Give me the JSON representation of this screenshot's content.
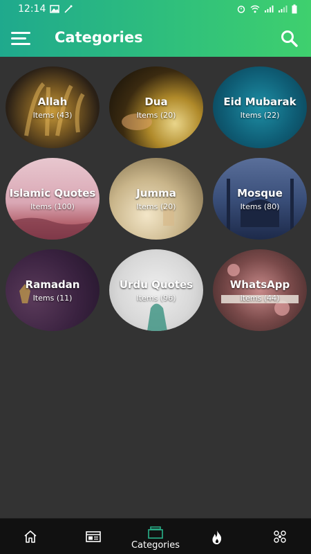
{
  "status_bar": {
    "time": "12:14"
  },
  "header": {
    "title": "Categories"
  },
  "categories": [
    {
      "name": "Allah",
      "count": "Items (43)"
    },
    {
      "name": "Dua",
      "count": "Items (20)"
    },
    {
      "name": "Eid Mubarak",
      "count": "Items (22)"
    },
    {
      "name": "Islamic Quotes",
      "count": "Items (100)"
    },
    {
      "name": "Jumma",
      "count": "Items (20)"
    },
    {
      "name": "Mosque",
      "count": "Items (80)"
    },
    {
      "name": "Ramadan",
      "count": "Items (11)"
    },
    {
      "name": "Urdu Quotes",
      "count": "Items (96)"
    },
    {
      "name": "WhatsApp",
      "count": "Items (44)"
    }
  ],
  "bottom_nav": {
    "items": [
      {
        "icon": "home-icon"
      },
      {
        "icon": "news-icon"
      },
      {
        "icon": "categories-icon",
        "label": "Categories",
        "active": true
      },
      {
        "icon": "fire-icon"
      },
      {
        "icon": "puzzle-icon"
      }
    ]
  },
  "colors": {
    "appbar_start": "#1fa98d",
    "appbar_end": "#3fd06e",
    "background": "#333333",
    "nav_background": "#111111",
    "active_icon": "#29b38a"
  }
}
